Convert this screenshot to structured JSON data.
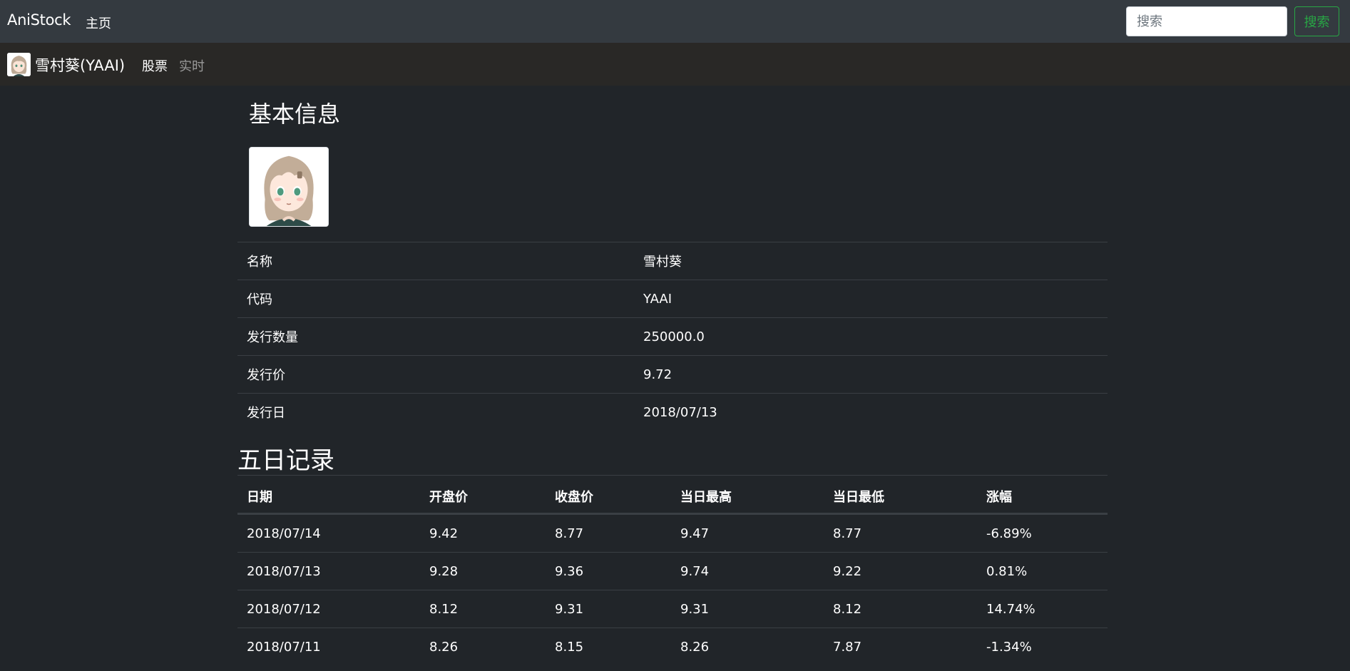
{
  "navbar": {
    "brand": "AniStock",
    "home": "主页",
    "search_placeholder": "搜索",
    "search_button": "搜索"
  },
  "subnav": {
    "title": "雪村葵(YAAI)",
    "tab_stock": "股票",
    "tab_live": "实时"
  },
  "basic_info": {
    "heading": "基本信息",
    "rows": [
      {
        "key": "名称",
        "value": "雪村葵"
      },
      {
        "key": "代码",
        "value": "YAAI"
      },
      {
        "key": "发行数量",
        "value": "250000.0"
      },
      {
        "key": "发行价",
        "value": "9.72"
      },
      {
        "key": "发行日",
        "value": "2018/07/13"
      }
    ]
  },
  "five_day": {
    "heading": "五日记录",
    "columns": [
      "日期",
      "开盘价",
      "收盘价",
      "当日最高",
      "当日最低",
      "涨幅"
    ],
    "rows": [
      [
        "2018/07/14",
        "9.42",
        "8.77",
        "9.47",
        "8.77",
        "-6.89%"
      ],
      [
        "2018/07/13",
        "9.28",
        "9.36",
        "9.74",
        "9.22",
        "0.81%"
      ],
      [
        "2018/07/12",
        "8.12",
        "9.31",
        "9.31",
        "8.12",
        "14.74%"
      ],
      [
        "2018/07/11",
        "8.26",
        "8.15",
        "8.26",
        "7.87",
        "-1.34%"
      ]
    ]
  },
  "colors": {
    "background": "#212529",
    "navbar": "#343a40",
    "subnav": "#292826",
    "success": "#28a745"
  }
}
